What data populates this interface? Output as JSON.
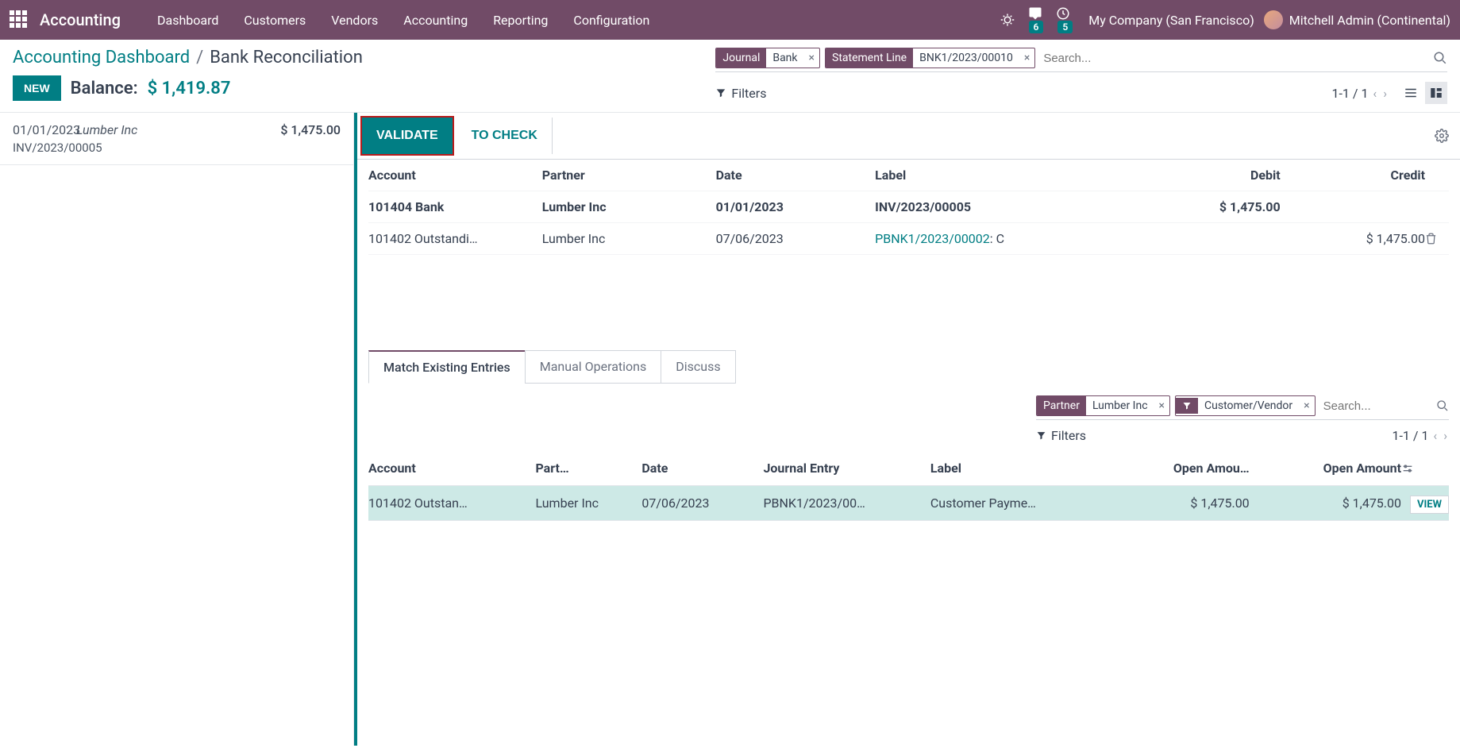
{
  "topnav": {
    "app_title": "Accounting",
    "menus": [
      "Dashboard",
      "Customers",
      "Vendors",
      "Accounting",
      "Reporting",
      "Configuration"
    ],
    "messages_badge": "6",
    "activities_badge": "5",
    "company": "My Company (San Francisco)",
    "user": "Mitchell Admin (Continental)"
  },
  "breadcrumb": {
    "link": "Accounting Dashboard",
    "current": "Bank Reconciliation"
  },
  "balance": {
    "new_label": "NEW",
    "label": "Balance:",
    "value": "$ 1,419.87"
  },
  "search": {
    "facets": [
      {
        "key": "Journal",
        "val": "Bank"
      },
      {
        "key": "Statement Line",
        "val": "BNK1/2023/00010"
      }
    ],
    "placeholder": "Search...",
    "filters_label": "Filters",
    "pager": "1-1 / 1"
  },
  "left_lines": [
    {
      "date": "01/01/2023",
      "partner": "Lumber Inc",
      "amount": "$ 1,475.00",
      "ref": "INV/2023/00005"
    }
  ],
  "actions": {
    "validate": "VALIDATE",
    "tocheck": "TO CHECK"
  },
  "entries": {
    "headers": {
      "account": "Account",
      "partner": "Partner",
      "date": "Date",
      "label": "Label",
      "debit": "Debit",
      "credit": "Credit"
    },
    "rows": [
      {
        "account": "101404 Bank",
        "partner": "Lumber Inc",
        "date": "01/01/2023",
        "label": "INV/2023/00005",
        "label_link": false,
        "debit": "$ 1,475.00",
        "credit": "",
        "bold": true,
        "trash": false
      },
      {
        "account": "101402 Outstandi…",
        "partner": "Lumber Inc",
        "date": "07/06/2023",
        "label_pre": "PBNK1/2023/00002",
        "label_post": ": C",
        "label_link": true,
        "debit": "",
        "credit": "$ 1,475.00",
        "bold": false,
        "trash": true
      }
    ]
  },
  "subtabs": [
    "Match Existing Entries",
    "Manual Operations",
    "Discuss"
  ],
  "inner_search": {
    "facet_partner_key": "Partner",
    "facet_partner_val": "Lumber Inc",
    "facet_cv": "Customer/Vendor",
    "placeholder": "Search...",
    "filters_label": "Filters",
    "pager": "1-1 / 1"
  },
  "match": {
    "headers": {
      "account": "Account",
      "partner": "Part…",
      "date": "Date",
      "journal": "Journal Entry",
      "label": "Label",
      "open1": "Open Amou…",
      "open2": "Open Amount"
    },
    "rows": [
      {
        "account": "101402 Outstan…",
        "partner": "Lumber Inc",
        "date": "07/06/2023",
        "journal": "PBNK1/2023/00…",
        "label": "Customer Payme…",
        "open1": "$ 1,475.00",
        "open2": "$ 1,475.00",
        "view": "VIEW"
      }
    ]
  }
}
